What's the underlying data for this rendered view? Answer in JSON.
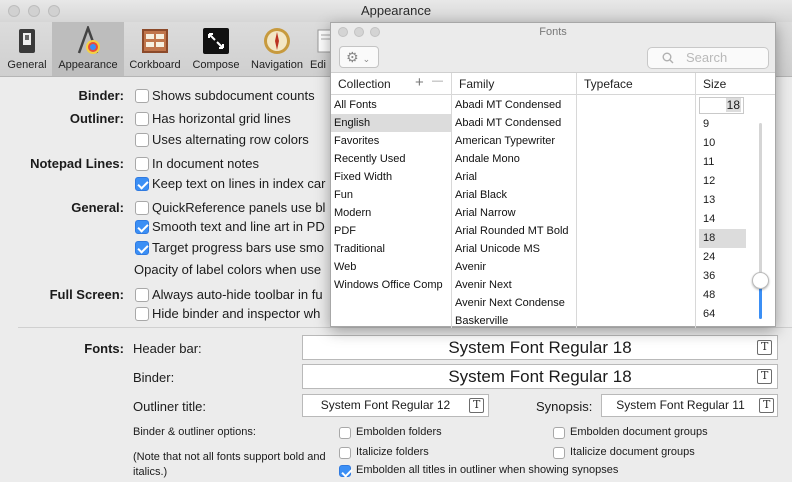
{
  "window": {
    "title": "Appearance"
  },
  "toolbar": {
    "items": [
      {
        "label": "General",
        "icon": "switch-icon"
      },
      {
        "label": "Appearance",
        "icon": "color-brush-icon",
        "selected": true
      },
      {
        "label": "Corkboard",
        "icon": "corkboard-icon"
      },
      {
        "label": "Compose",
        "icon": "fullscreen-icon"
      },
      {
        "label": "Navigation",
        "icon": "compass-icon"
      },
      {
        "label": "Edi",
        "icon": "editing-icon"
      }
    ]
  },
  "prefs": {
    "binder": {
      "label": "Binder:",
      "options": [
        {
          "text": "Shows subdocument counts",
          "checked": false
        }
      ]
    },
    "outliner": {
      "label": "Outliner:",
      "options": [
        {
          "text": "Has horizontal grid lines",
          "checked": false
        },
        {
          "text": "Uses alternating row colors",
          "checked": false
        }
      ]
    },
    "notepad": {
      "label": "Notepad Lines:",
      "options": [
        {
          "text": "In document notes",
          "checked": false
        },
        {
          "text": "Keep text on lines in index car",
          "checked": true
        }
      ]
    },
    "general": {
      "label": "General:",
      "options": [
        {
          "text": "QuickReference panels use bl",
          "checked": false
        },
        {
          "text": "Smooth text and line art in PD",
          "checked": true
        },
        {
          "text": "Target progress bars use smo",
          "checked": true
        }
      ],
      "opacity_text": "Opacity of label colors when use"
    },
    "fullscreen": {
      "label": "Full Screen:",
      "options": [
        {
          "text": "Always auto-hide toolbar in fu",
          "checked": false
        },
        {
          "text": "Hide binder and inspector wh",
          "checked": false
        }
      ]
    }
  },
  "fonts": {
    "label": "Fonts:",
    "header_bar": {
      "label": "Header bar:",
      "value": "System Font Regular 18"
    },
    "binder": {
      "label": "Binder:",
      "value": "System Font Regular 18"
    },
    "outliner_title": {
      "label": "Outliner title:",
      "value": "System Font Regular 12"
    },
    "synopsis": {
      "label": "Synopsis:",
      "value": "System Font Regular 11"
    },
    "options_label": "Binder & outliner options:",
    "note": "(Note that not all fonts support bold and italics.)",
    "options": [
      {
        "text": "Embolden folders",
        "checked": false
      },
      {
        "text": "Embolden document groups",
        "checked": false
      },
      {
        "text": "Italicize folders",
        "checked": false
      },
      {
        "text": "Italicize document groups",
        "checked": false
      },
      {
        "text": "Embolden all titles in outliner when showing synopses",
        "checked": true
      }
    ]
  },
  "fonts_panel": {
    "title": "Fonts",
    "search_placeholder": "Search",
    "headers": {
      "collection": "Collection",
      "add": "+",
      "remove": "—",
      "family": "Family",
      "typeface": "Typeface",
      "size": "Size"
    },
    "collections": [
      "All Fonts",
      "English",
      "Favorites",
      "Recently Used",
      "Fixed Width",
      "Fun",
      "Modern",
      "PDF",
      "Traditional",
      "Web",
      "Windows Office Comp"
    ],
    "selected_collection": "English",
    "families": [
      "Abadi MT Condensed",
      "Abadi MT Condensed",
      "American Typewriter",
      "Andale Mono",
      "Arial",
      "Arial Black",
      "Arial Narrow",
      "Arial Rounded MT Bold",
      "Arial Unicode MS",
      "Avenir",
      "Avenir Next",
      "Avenir Next Condense",
      "Baskerville"
    ],
    "size_value": "18",
    "sizes": [
      "9",
      "10",
      "11",
      "12",
      "13",
      "14",
      "18",
      "24",
      "36",
      "48",
      "64"
    ],
    "selected_size": "18",
    "slider_level": 0.2
  }
}
